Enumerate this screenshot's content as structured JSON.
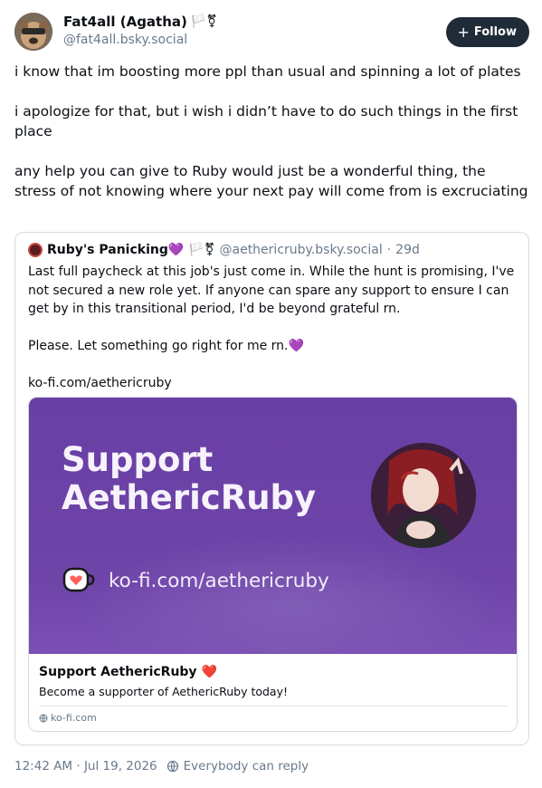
{
  "author": {
    "display_name": "Fat4all (Agatha)",
    "flags": "🏳️⚧",
    "handle": "@fat4all.bsky.social",
    "follow_label": "Follow",
    "follow_icon": "+"
  },
  "post": {
    "paragraphs": [
      "i know that im boosting more ppl than usual and spinning a lot of plates",
      "i apologize for that, but i wish i didn’t have to do such things in the first place",
      "any help you can give to Ruby would just be a wonderful thing, the stress of not knowing where your next pay will come from is excruciating"
    ]
  },
  "quote": {
    "name": "Ruby's Panicking",
    "name_emoji": "💜",
    "flags": "🏳️⚧",
    "handle": "@aethericruby.bsky.social",
    "separator": "·",
    "age": "29d",
    "paragraph_1": "Last full paycheck at this job's just come in. While the hunt is promising, I've not secured a new role yet. If anyone can spare any support to ensure I can get by in this transitional period, I'd be beyond grateful rn.",
    "paragraph_2": "Please. Let something go right for me rn.",
    "paragraph_2_emoji": "💜",
    "paragraph_3": "ko-fi.com/aethericruby",
    "card": {
      "image_title_line1": "Support",
      "image_title_line2": "AethericRuby",
      "image_url": "ko-fi.com/aethericruby",
      "title": "Support AethericRuby",
      "title_emoji": "❤️",
      "description": "Become a supporter of AethericRuby today!",
      "domain": "ko-fi.com"
    }
  },
  "footer": {
    "timestamp": "12:42 AM · Jul 19, 2026",
    "reply_setting": "Everybody can reply"
  },
  "colors": {
    "accent_dark": "#1f2b37",
    "card_purple": "#6e44a9",
    "muted": "#6a7a8c"
  }
}
